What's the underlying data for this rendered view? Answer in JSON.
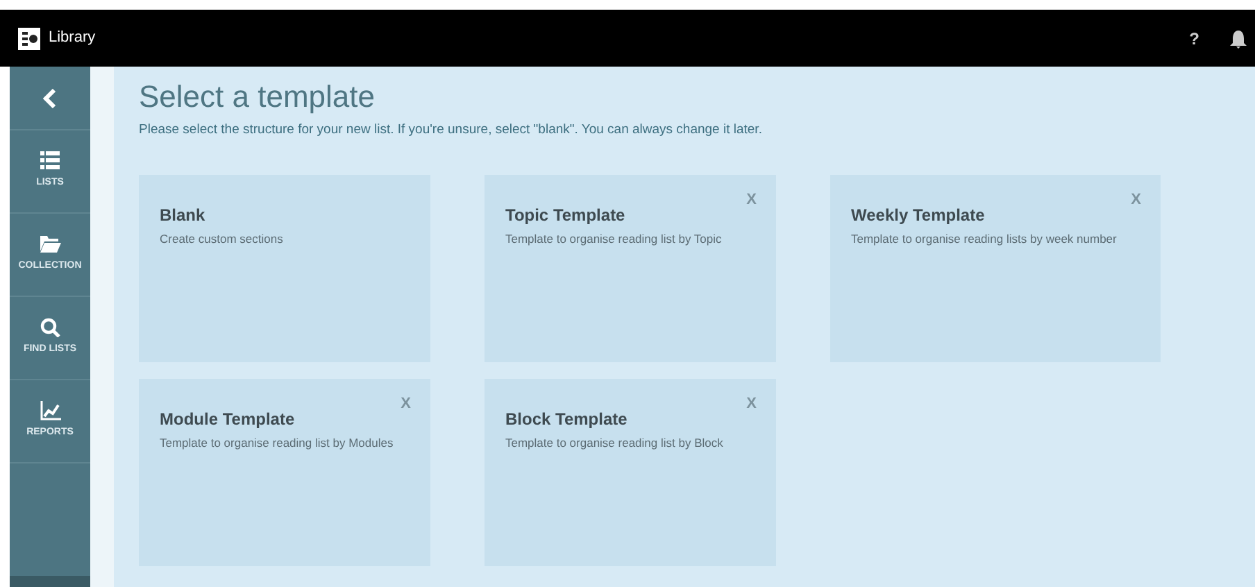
{
  "header": {
    "title": "Library",
    "help": "?"
  },
  "sidebar": {
    "items": [
      {
        "kind": "lists",
        "label": "LISTS"
      },
      {
        "kind": "collection",
        "label": "COLLECTION"
      },
      {
        "kind": "search",
        "label": "FIND LISTS"
      },
      {
        "kind": "reports",
        "label": "REPORTS"
      }
    ]
  },
  "page": {
    "title": "Select a template",
    "subtitle": "Please select the structure for your new list. If you're unsure, select \"blank\". You can always change it later."
  },
  "templates": [
    {
      "title": "Blank",
      "description": "Create custom sections"
    },
    {
      "title": "Topic Template",
      "description": "Template to organise reading list by Topic",
      "close": "X"
    },
    {
      "title": "Weekly Template",
      "description": "Template to organise reading lists by week number",
      "close": "X"
    },
    {
      "title": "Module Template",
      "description": "Template to organise reading list by Modules",
      "close": "X"
    },
    {
      "title": "Block Template",
      "description": "Template to organise reading list by Block",
      "close": "X"
    }
  ]
}
